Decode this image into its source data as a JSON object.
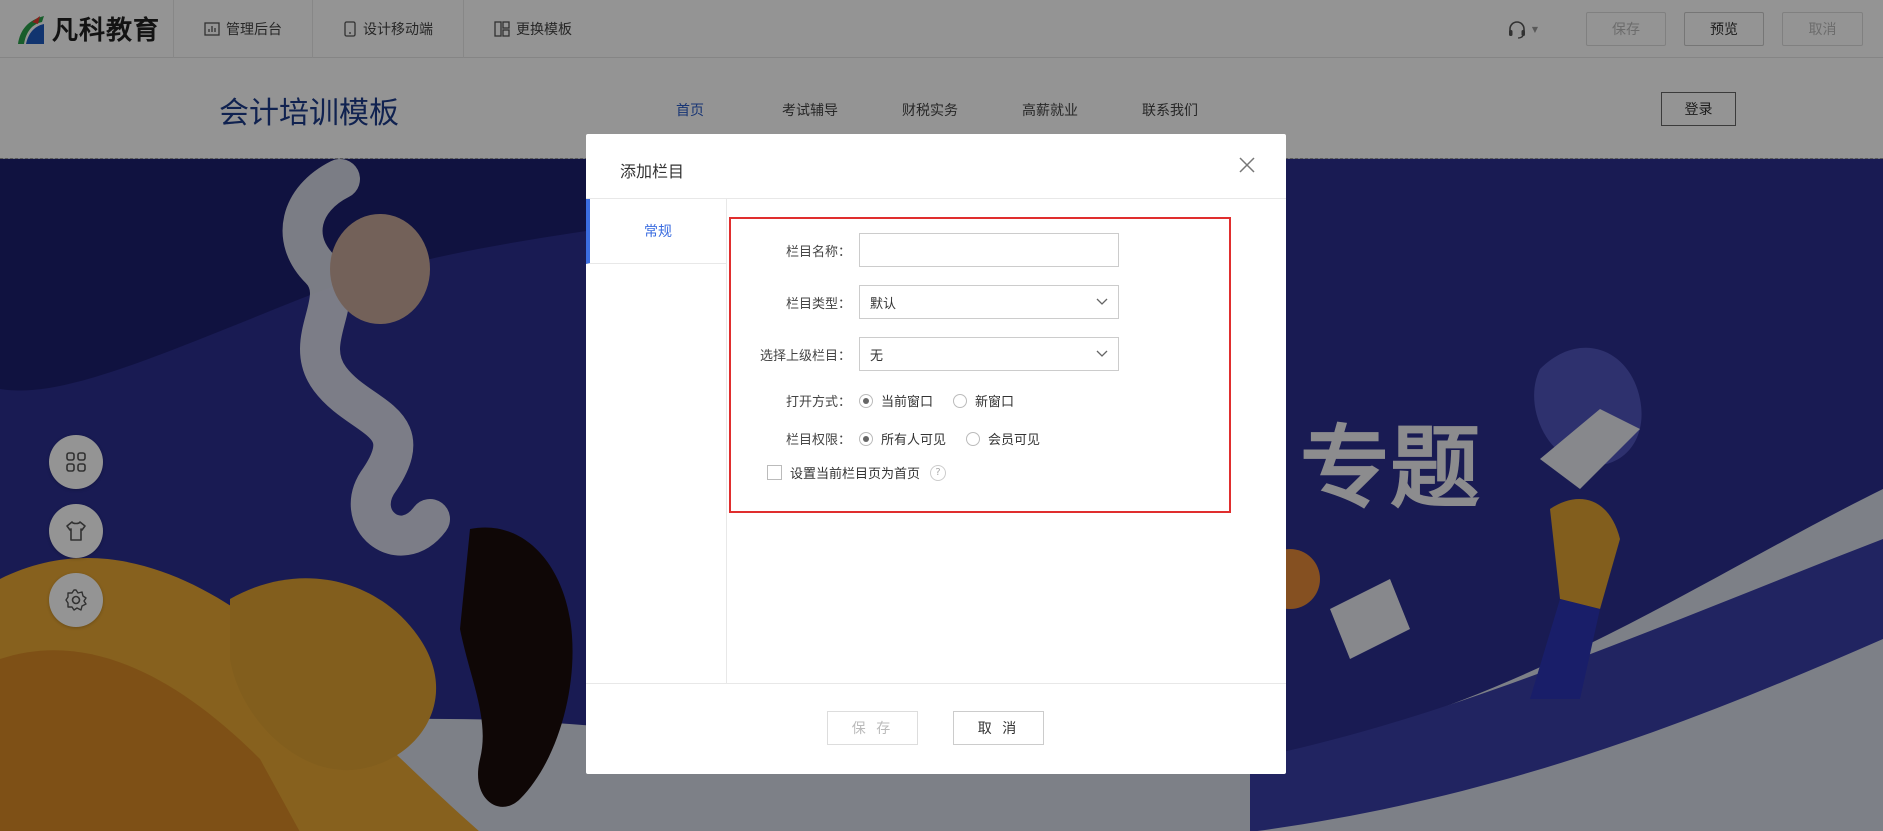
{
  "brand": {
    "name": "凡科教育"
  },
  "toolbar": {
    "tabs": [
      "管理后台",
      "设计移动端",
      "更换模板"
    ],
    "save_label": "保存",
    "preview_label": "预览",
    "cancel_label": "取消"
  },
  "site": {
    "title": "会计培训模板",
    "nav": [
      "首页",
      "考试辅导",
      "财税实务",
      "高薪就业",
      "联系我们"
    ],
    "login_label": "登录"
  },
  "banner": {
    "visible_text": "专题"
  },
  "modal": {
    "title": "添加栏目",
    "side_tab": "常规",
    "fields": {
      "name_label": "栏目名称：",
      "name_value": "",
      "type_label": "栏目类型：",
      "type_value": "默认",
      "parent_label": "选择上级栏目：",
      "parent_value": "无",
      "open_label": "打开方式：",
      "open_options": [
        "当前窗口",
        "新窗口"
      ],
      "open_selected": "当前窗口",
      "perm_label": "栏目权限：",
      "perm_options": [
        "所有人可见",
        "会员可见"
      ],
      "perm_selected": "所有人可见",
      "homepage_label": "设置当前栏目页为首页",
      "homepage_checked": false,
      "help_glyph": "?"
    },
    "save_label": "保 存",
    "cancel_label": "取 消"
  },
  "colors": {
    "accent": "#3b6de0",
    "highlight_border": "#e02e2e",
    "banner_blue": "#2b2f8f"
  }
}
